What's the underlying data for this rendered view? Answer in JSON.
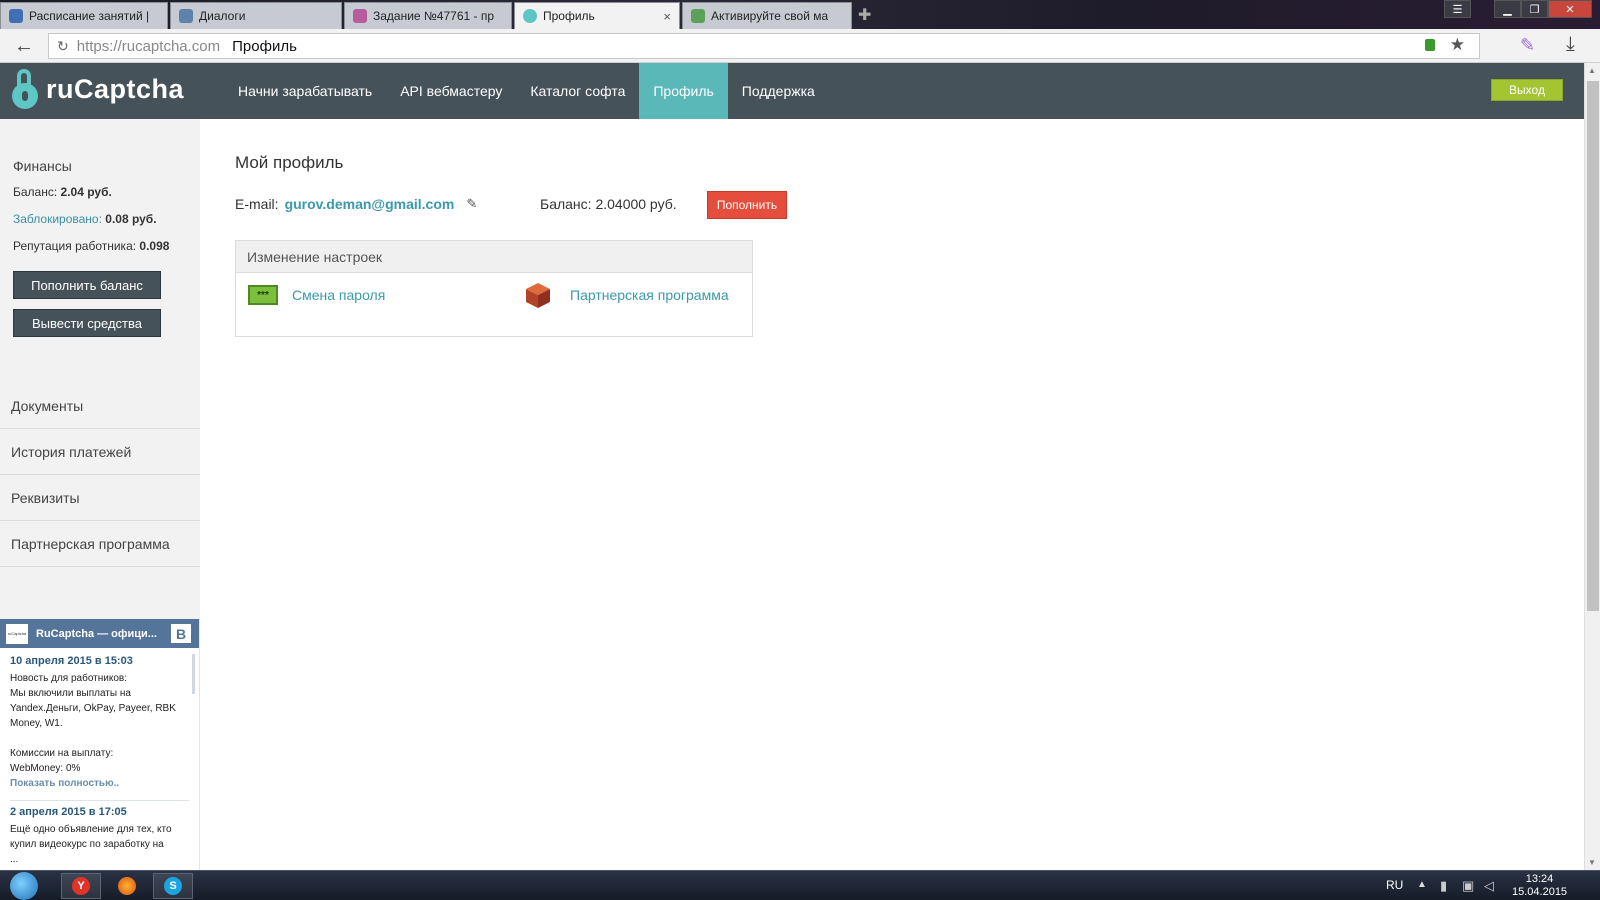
{
  "browser": {
    "tabs": [
      {
        "title": "Расписание занятий |",
        "icon_color": "#3f6fb3"
      },
      {
        "title": "Диалоги",
        "icon_color": "#5f82ad"
      },
      {
        "title": "Задание №47761 - пр",
        "icon_color": "#b95c9e"
      },
      {
        "title": "Профиль",
        "icon_color": "#5ec6c4",
        "active": true
      },
      {
        "title": "Активируйте свой ма",
        "icon_color": "#5aa15a"
      }
    ],
    "close_glyph": "×",
    "url_host": "https://rucaptcha.com",
    "page_name": "Профиль"
  },
  "site": {
    "logo_text": "ruCaptcha",
    "nav": [
      "Начни зарабатывать",
      "API вебмастеру",
      "Каталог софта",
      "Профиль",
      "Поддержка"
    ],
    "active_nav": "Профиль",
    "logout_label": "Выход",
    "accent_color": "#5ab8b8"
  },
  "sidebar": {
    "finance_title": "Финансы",
    "balance_label": "Баланс:",
    "balance_value": "2.04 руб.",
    "blocked_label": "Заблокировано:",
    "blocked_value": "0.08 руб.",
    "reputation_label": "Репутация работника:",
    "reputation_value": "0.098",
    "topup_button": "Пополнить баланс",
    "withdraw_button": "Вывести средства",
    "menu": [
      "Документы",
      "История платежей",
      "Реквизиты",
      "Партнерская программа"
    ]
  },
  "vk_widget": {
    "title": "RuCaptcha — офици...",
    "thumb_text": "ruCaptcha",
    "badge": "В",
    "posts": [
      {
        "date": "10 апреля 2015 в 15:03",
        "lines": [
          "Новость для работников:",
          "Мы включили выплаты на Yandex.Деньги, OkPay, Payeer, RBK Money, W1.",
          "",
          "Комиссии на выплату:",
          "WebMoney: 0%"
        ],
        "more": "Показать полностью.."
      },
      {
        "date": "2 апреля 2015 в 17:05",
        "lines": [
          "Ещё одно объявление для тех, кто купил видеокурс по заработку на",
          "..."
        ]
      }
    ]
  },
  "main": {
    "title": "Мой профиль",
    "email_label": "E-mail:",
    "email": "gurov.deman@gmail.com",
    "balance_text": "Баланс: 2.04000 руб.",
    "topup_button": "Пополнить",
    "settings_title": "Изменение настроек",
    "password_icon_text": "***",
    "change_password": "Смена пароля",
    "partner_program": "Партнерская программа"
  },
  "taskbar": {
    "lang": "RU",
    "time": "13:24",
    "date": "15.04.2015"
  }
}
